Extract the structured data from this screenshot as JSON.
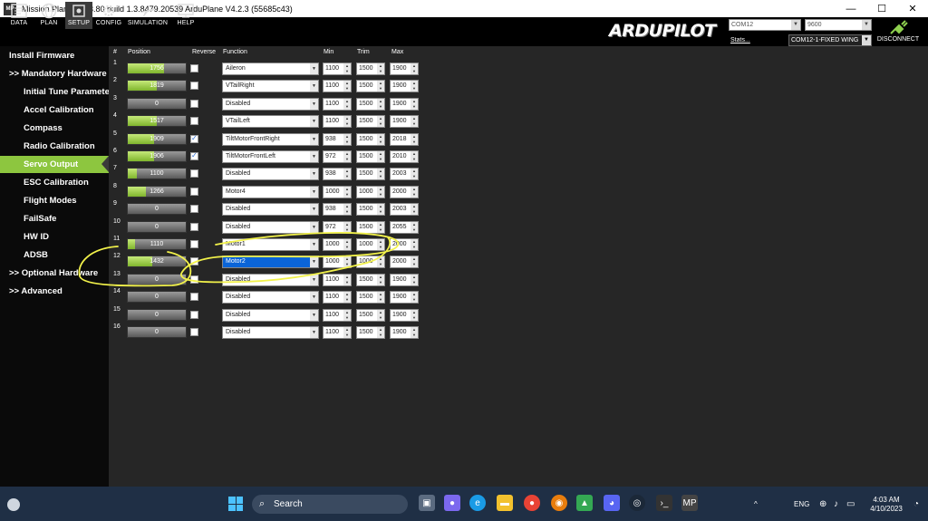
{
  "window": {
    "title": "Mission Planner 1.3.80 build 1.3.8479.20539 ArduPlane V4.2.3 (55685c43)",
    "app_icon": "MP",
    "minimize": "—",
    "maximize": "☐",
    "close": "✕"
  },
  "toolbar": {
    "data": "DATA",
    "plan": "PLAN",
    "setup": "SETUP",
    "config": "CONFIG",
    "simulation": "SIMULATION",
    "help": "HELP",
    "logo": "ARDUPILOT",
    "stats": "Stats...",
    "port": "COM12",
    "baud": "9600",
    "vehicle": "COM12-1-FIXED WING",
    "disconnect": "DISCONNECT"
  },
  "sidebar": {
    "items": [
      {
        "label": "Install Firmware",
        "level": 0
      },
      {
        "label": ">> Mandatory Hardware",
        "level": 0
      },
      {
        "label": "Initial Tune Parameters",
        "level": 1
      },
      {
        "label": "Accel Calibration",
        "level": 1
      },
      {
        "label": "Compass",
        "level": 1
      },
      {
        "label": "Radio Calibration",
        "level": 1
      },
      {
        "label": "Servo Output",
        "level": 1,
        "active": true
      },
      {
        "label": "ESC Calibration",
        "level": 1
      },
      {
        "label": "Flight Modes",
        "level": 1
      },
      {
        "label": "FailSafe",
        "level": 1
      },
      {
        "label": "HW ID",
        "level": 1
      },
      {
        "label": "ADSB",
        "level": 1
      },
      {
        "label": ">> Optional Hardware",
        "level": 0
      },
      {
        "label": ">> Advanced",
        "level": 0
      }
    ]
  },
  "servo": {
    "headers": {
      "num": "#",
      "position": "Position",
      "reverse": "Reverse",
      "function": "Function",
      "min": "Min",
      "trim": "Trim",
      "max": "Max"
    },
    "rows": [
      {
        "n": "1",
        "pos": "1756",
        "fill": 0.63,
        "rev": false,
        "func": "Aileron",
        "min": "1100",
        "trim": "1500",
        "max": "1900"
      },
      {
        "n": "2",
        "pos": "1819",
        "fill": 0.5,
        "rev": false,
        "func": "VTailRight",
        "min": "1100",
        "trim": "1500",
        "max": "1900"
      },
      {
        "n": "3",
        "pos": "0",
        "fill": 0,
        "rev": false,
        "func": "Disabled",
        "min": "1100",
        "trim": "1500",
        "max": "1900"
      },
      {
        "n": "4",
        "pos": "1517",
        "fill": 0.5,
        "rev": false,
        "func": "VTailLeft",
        "min": "1100",
        "trim": "1500",
        "max": "1900"
      },
      {
        "n": "5",
        "pos": "1909",
        "fill": 0.45,
        "rev": true,
        "func": "TiltMotorFrontRight",
        "min": "938",
        "trim": "1500",
        "max": "2018"
      },
      {
        "n": "6",
        "pos": "1906",
        "fill": 0.45,
        "rev": true,
        "func": "TiltMotorFrontLeft",
        "min": "972",
        "trim": "1500",
        "max": "2010"
      },
      {
        "n": "7",
        "pos": "1100",
        "fill": 0.15,
        "rev": false,
        "func": "Disabled",
        "min": "938",
        "trim": "1500",
        "max": "2003"
      },
      {
        "n": "8",
        "pos": "1266",
        "fill": 0.32,
        "rev": false,
        "func": "Motor4",
        "min": "1000",
        "trim": "1000",
        "max": "2000"
      },
      {
        "n": "9",
        "pos": "0",
        "fill": 0,
        "rev": false,
        "func": "Disabled",
        "min": "938",
        "trim": "1500",
        "max": "2003"
      },
      {
        "n": "10",
        "pos": "0",
        "fill": 0,
        "rev": false,
        "func": "Disabled",
        "min": "972",
        "trim": "1500",
        "max": "2055"
      },
      {
        "n": "11",
        "pos": "1110",
        "fill": 0.12,
        "rev": false,
        "func": "Motor1",
        "min": "1000",
        "trim": "1000",
        "max": "2000"
      },
      {
        "n": "12",
        "pos": "1432",
        "fill": 0.42,
        "rev": false,
        "func": "Motor2",
        "min": "1000",
        "trim": "1000",
        "max": "2000",
        "selected": true
      },
      {
        "n": "13",
        "pos": "0",
        "fill": 0,
        "rev": false,
        "func": "Disabled",
        "min": "1100",
        "trim": "1500",
        "max": "1900"
      },
      {
        "n": "14",
        "pos": "0",
        "fill": 0,
        "rev": false,
        "func": "Disabled",
        "min": "1100",
        "trim": "1500",
        "max": "1900"
      },
      {
        "n": "15",
        "pos": "0",
        "fill": 0,
        "rev": false,
        "func": "Disabled",
        "min": "1100",
        "trim": "1500",
        "max": "1900"
      },
      {
        "n": "16",
        "pos": "0",
        "fill": 0,
        "rev": false,
        "func": "Disabled",
        "min": "1100",
        "trim": "1500",
        "max": "1900"
      }
    ]
  },
  "taskbar": {
    "search": "Search",
    "lang": "ENG",
    "time": "4:03 AM",
    "date": "4/10/2023",
    "apps": [
      "windows-start-icon",
      "search-icon",
      "task-view-icon",
      "chat-icon",
      "edge-icon",
      "file-explorer-icon",
      "chrome-icon",
      "blender-icon",
      "drive-icon",
      "discord-icon",
      "steam-icon",
      "terminal-icon",
      "mission-planner-icon"
    ]
  },
  "colors": {
    "accent_green": "#8dc63f",
    "selected_blue": "#0a64d8",
    "annotation_yellow": "#f2f24a"
  }
}
